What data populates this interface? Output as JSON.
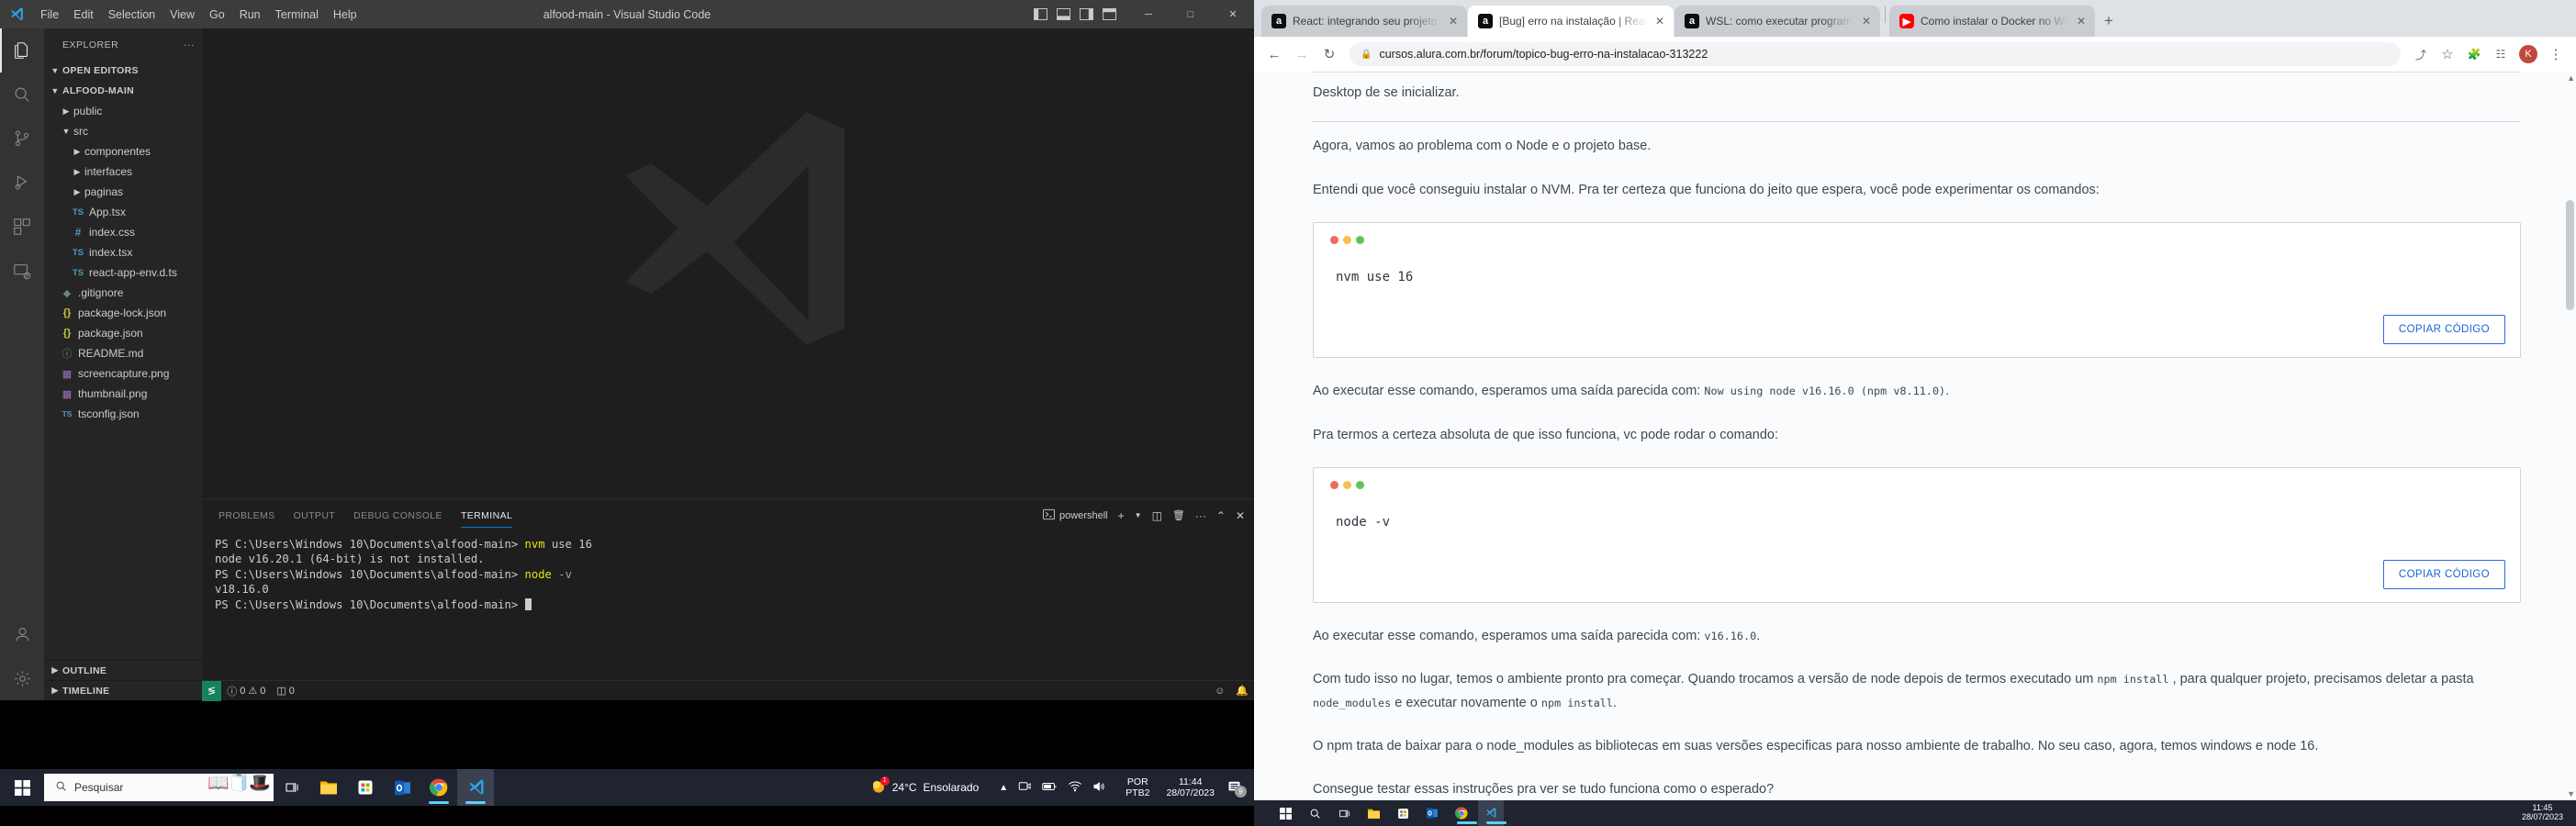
{
  "vscode": {
    "title": "alfood-main - Visual Studio Code",
    "menu": [
      "File",
      "Edit",
      "Selection",
      "View",
      "Go",
      "Run",
      "Terminal",
      "Help"
    ],
    "window_controls": {
      "minimize": "─",
      "maximize": "□",
      "close": "✕"
    },
    "sidebar": {
      "header": "EXPLORER",
      "more_actions": "···",
      "sections": [
        "OPEN EDITORS",
        "ALFOOD-MAIN"
      ],
      "tree": [
        {
          "label": "public",
          "kind": "folder",
          "depth": 1,
          "expanded": false
        },
        {
          "label": "src",
          "kind": "folder",
          "depth": 1,
          "expanded": true
        },
        {
          "label": "componentes",
          "kind": "folder",
          "depth": 2,
          "expanded": false
        },
        {
          "label": "interfaces",
          "kind": "folder",
          "depth": 2,
          "expanded": false
        },
        {
          "label": "paginas",
          "kind": "folder",
          "depth": 2,
          "expanded": false
        },
        {
          "label": "App.tsx",
          "kind": "ts",
          "depth": 2
        },
        {
          "label": "index.css",
          "kind": "css",
          "depth": 2
        },
        {
          "label": "index.tsx",
          "kind": "ts",
          "depth": 2
        },
        {
          "label": "react-app-env.d.ts",
          "kind": "ts",
          "depth": 2
        },
        {
          "label": ".gitignore",
          "kind": "git",
          "depth": 1
        },
        {
          "label": "package-lock.json",
          "kind": "json",
          "depth": 1
        },
        {
          "label": "package.json",
          "kind": "json",
          "depth": 1
        },
        {
          "label": "README.md",
          "kind": "md",
          "depth": 1
        },
        {
          "label": "screencapture.png",
          "kind": "png",
          "depth": 1
        },
        {
          "label": "thumbnail.png",
          "kind": "png",
          "depth": 1
        },
        {
          "label": "tsconfig.json",
          "kind": "tsjson",
          "depth": 1
        }
      ],
      "bottom_sections": [
        "OUTLINE",
        "TIMELINE"
      ]
    },
    "panel": {
      "tabs": [
        "PROBLEMS",
        "OUTPUT",
        "DEBUG CONSOLE",
        "TERMINAL"
      ],
      "active_tab": "TERMINAL",
      "shell_label": "powershell",
      "actions": {
        "new": "+",
        "split": "◫",
        "kill": "🗑",
        "more": "···",
        "maximize": "⌃",
        "close": "✕"
      },
      "terminal_lines": [
        {
          "prompt": "PS C:\\Users\\Windows 10\\Documents\\alfood-main> ",
          "cmd": "nvm",
          "args": " use 16"
        },
        {
          "output": "node v16.20.1 (64-bit) is not installed."
        },
        {
          "prompt": "PS C:\\Users\\Windows 10\\Documents\\alfood-main> ",
          "cmd": "node",
          "flag": " -v"
        },
        {
          "output": "v18.16.0"
        },
        {
          "prompt": "PS C:\\Users\\Windows 10\\Documents\\alfood-main> ",
          "caret": true
        }
      ]
    },
    "statusbar": {
      "remote": "≶",
      "errors": "0",
      "warnings": "0",
      "ports": "0",
      "bell": "🔔",
      "feedback": "☺"
    }
  },
  "chrome": {
    "tabs": [
      {
        "title": "React: integrando seu projeto Rea",
        "favicon": "alura-icon",
        "active": false
      },
      {
        "title": "[Bug] erro na instalação | React: i",
        "favicon": "alura-icon",
        "active": true
      },
      {
        "title": "WSL: como executar programas e",
        "favicon": "alura-icon",
        "active": false
      },
      {
        "title": "Como instalar o Docker no Windo",
        "favicon": "youtube-icon",
        "active": false
      }
    ],
    "new_tab": "+",
    "tab_close": "✕",
    "toolbar": {
      "back": "←",
      "forward": "→",
      "reload": "↻",
      "lock": "🔒",
      "url": "cursos.alura.com.br/forum/topico-bug-erro-na-instalacao-313222",
      "share": "⤴",
      "bookmark": "☆",
      "extensions": "🧩",
      "reading_list": "☷",
      "avatar_letter": "K",
      "menu": "⋮"
    },
    "page": {
      "paragraphs": [
        {
          "id": "p1",
          "text": "Desktop de se inicializar."
        },
        {
          "id": "p2",
          "text": "Agora, vamos ao problema com o Node e o projeto base."
        },
        {
          "id": "p3",
          "text": "Entendi que você conseguiu instalar o NVM. Pra ter certeza que funciona do jeito que espera, você pode experimentar os comandos:"
        }
      ],
      "code_blocks": [
        {
          "id": "cb1",
          "code": "nvm use 16",
          "copy_label": "COPIAR CÓDIGO"
        },
        {
          "id": "cb2",
          "code": "node -v",
          "copy_label": "COPIAR CÓDIGO"
        }
      ],
      "after_cb1": {
        "lead": "Ao executar esse comando, esperamos uma saída parecida com:",
        "mono": "Now using node v16.16.0 (npm v8.11.0)",
        "tail": "."
      },
      "mid_text": "Pra termos a certeza absoluta de que isso funciona, vc pode rodar o comando:",
      "after_cb2": {
        "lead": "Ao executar esse comando, esperamos uma saída parecida com:",
        "mono": "v16.16.0",
        "tail": "."
      },
      "para_npm": {
        "part1": "Com tudo isso no lugar, temos o ambiente pronto pra começar. Quando trocamos a versão de node depois de termos executado um",
        "mono1": "npm install",
        "part2": ", para qualquer projeto, precisamos deletar a pasta",
        "mono2": "node_modules",
        "part3": "e executar novamente o",
        "mono3": "npm install",
        "part4": "."
      },
      "para_last": "O npm trata de baixar para o node_modules as bibliotecas em suas versões especificas para nosso ambiente de trabalho. No seu caso, agora, temos windows e node 16.",
      "para_question": "Consegue testar essas instruções pra ver se tudo funciona como o esperado?"
    }
  },
  "taskbar": {
    "start": "windows-logo",
    "search_placeholder": "Pesquisar",
    "search_icon": "search-icon",
    "pinned": [
      {
        "name": "task-view",
        "glyph": "⌷"
      },
      {
        "name": "file-explorer",
        "glyph": "📁"
      },
      {
        "name": "microsoft-store",
        "glyph": "🏪"
      },
      {
        "name": "outlook",
        "glyph": "📧"
      },
      {
        "name": "google-chrome",
        "glyph": "◎"
      },
      {
        "name": "visual-studio-code",
        "glyph": "⬡"
      }
    ],
    "weather": {
      "temp": "24°C",
      "desc": "Ensolarado"
    },
    "system_icons": [
      "⌃",
      "📷",
      "🔌",
      "📶",
      "🔊"
    ],
    "language": {
      "line1": "POR",
      "line2": "PTB2"
    },
    "clock": {
      "time": "11:44",
      "date": "28/07/2023"
    },
    "notifications": {
      "icon": "☰",
      "count": "9"
    },
    "chrome_clock": {
      "time": "11:45",
      "date": "28/07/2023"
    }
  },
  "colors": {
    "vscode_bg": "#1e1e1e",
    "vscode_sidebar": "#252526",
    "vscode_activitybar": "#333333",
    "accent_blue": "#0078d4",
    "remote_green": "#16825d",
    "taskbar": "#1f2430",
    "forum_text": "#3e4854",
    "copy_btn_blue": "#1a63d8"
  }
}
